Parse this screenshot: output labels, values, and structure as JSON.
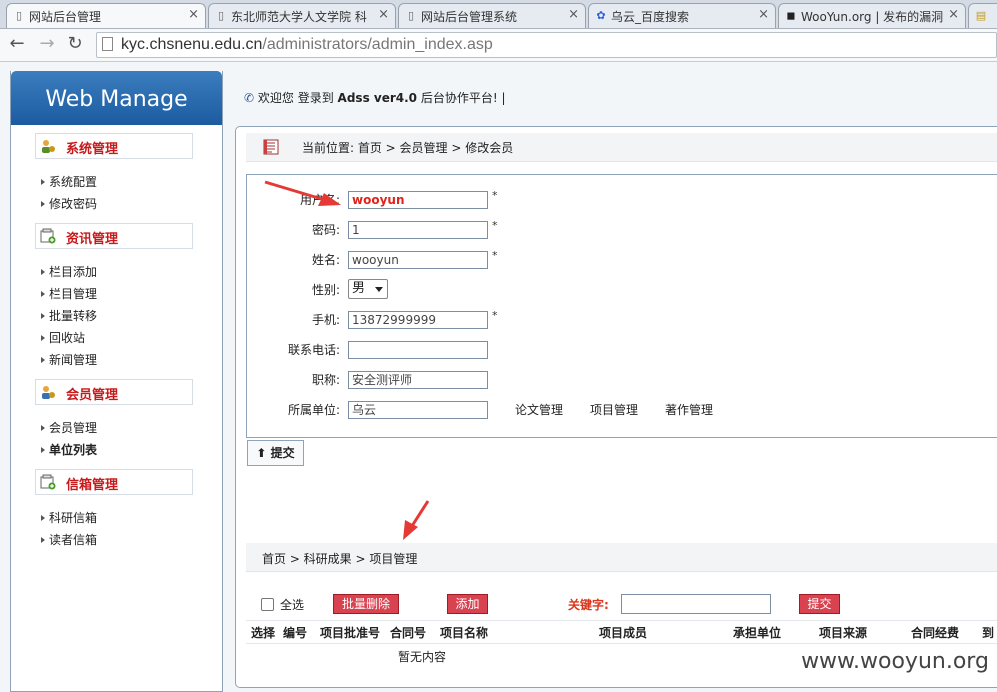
{
  "browser": {
    "tabs": [
      {
        "title": "网站后台管理",
        "active": true
      },
      {
        "title": "东北师范大学人文学院 科",
        "active": false
      },
      {
        "title": "网站后台管理系统",
        "active": false
      },
      {
        "title": "乌云_百度搜索",
        "active": false
      },
      {
        "title": "WooYun.org | 发布的漏洞",
        "active": false
      }
    ],
    "url_host": "kyc.chsnenu.edu.cn",
    "url_path": "/administrators/admin_index.asp"
  },
  "sidebar": {
    "brand": "Web Manage",
    "groups": [
      {
        "title": "系统管理",
        "items": [
          "系统配置",
          "修改密码"
        ]
      },
      {
        "title": "资讯管理",
        "items": [
          "栏目添加",
          "栏目管理",
          "批量转移",
          "回收站",
          "新闻管理"
        ]
      },
      {
        "title": "会员管理",
        "items": [
          "会员管理",
          "单位列表"
        ]
      },
      {
        "title": "信箱管理",
        "items": [
          "科研信箱",
          "读者信箱"
        ]
      }
    ]
  },
  "welcome": {
    "prefix": "欢迎您 登录到",
    "product": "Adss ver4.0",
    "suffix": "后台协作平台!",
    "cursor": "|"
  },
  "breadcrumb": "当前位置: 首页 > 会员管理 > 修改会员",
  "form": {
    "username_label": "用户名:",
    "username_value": "wooyun",
    "password_label": "密码:",
    "password_value": "1",
    "name_label": "姓名:",
    "name_value": "wooyun",
    "gender_label": "性别:",
    "gender_value": "男",
    "mobile_label": "手机:",
    "mobile_value": "13872999999",
    "phone_label": "联系电话:",
    "phone_value": "",
    "title_label": "职称:",
    "title_value": "安全测评师",
    "unit_label": "所属单位:",
    "unit_value": "乌云",
    "required_mark": "*",
    "links": [
      "论文管理",
      "项目管理",
      "著作管理"
    ]
  },
  "submit_label": "提交",
  "breadcrumb2": "首页 > 科研成果 > 项目管理",
  "toolbar": {
    "select_all": "全选",
    "batch_delete": "批量删除",
    "add": "添加",
    "keyword_label": "关键字:",
    "submit": "提交"
  },
  "table": {
    "columns": [
      "选择",
      "编号",
      "项目批准号",
      "合同号",
      "项目名称",
      "项目成员",
      "承担单位",
      "项目来源",
      "合同经费",
      "到"
    ],
    "empty_text": "暂无内容"
  },
  "watermark": "www.wooyun.org",
  "colors": {
    "brand_blue": "#1c5ba0",
    "menu_title_red": "#c8191b",
    "button_red": "#d9424f",
    "annotation_red": "#e53935"
  }
}
